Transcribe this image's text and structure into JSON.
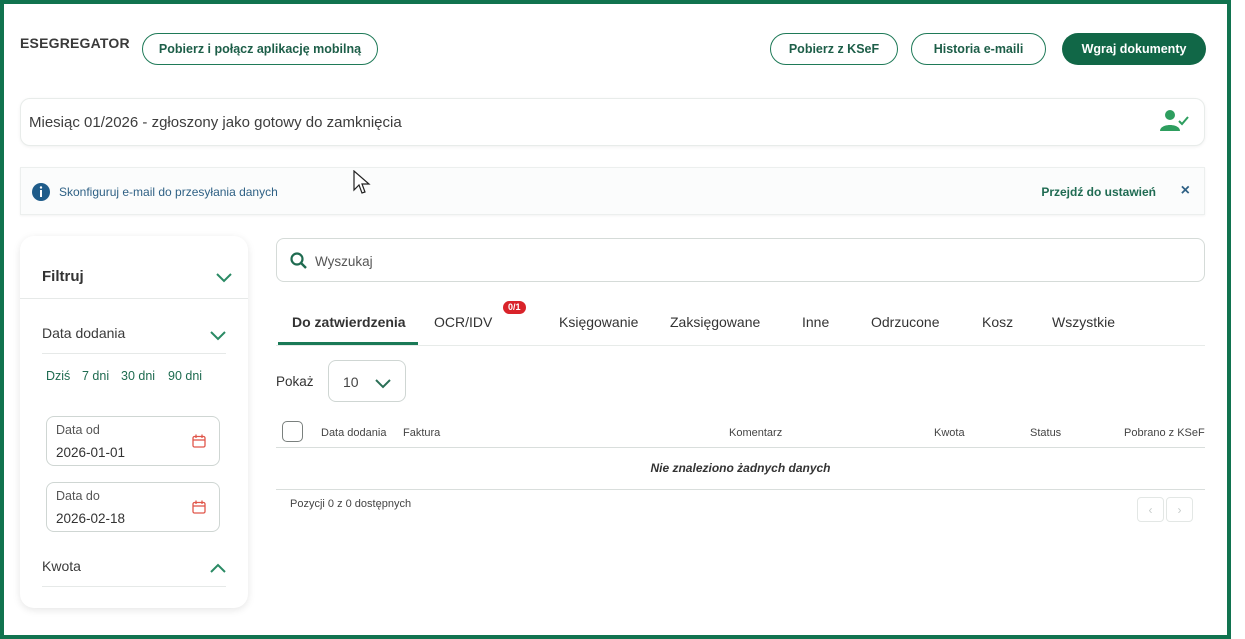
{
  "app": {
    "brand": "ESEGREGATOR"
  },
  "header": {
    "mobile_app_button": "Pobierz i połącz aplikację mobilną",
    "ksef_button": "Pobierz z KSeF",
    "email_history_button": "Historia e-maili",
    "upload_button": "Wgraj dokumenty"
  },
  "month_status": {
    "text": "Miesiąc 01/2026 - zgłoszony jako gotowy do zamknięcia"
  },
  "info_banner": {
    "text": "Skonfiguruj e-mail do przesyłania danych",
    "link": "Przejdź do ustawień",
    "close": "×"
  },
  "filters": {
    "title": "Filtruj",
    "date_added_label": "Data dodania",
    "quick_ranges": [
      "Dziś",
      "7 dni",
      "30 dni",
      "90 dni"
    ],
    "date_from": {
      "label": "Data od",
      "value": "2026-01-01"
    },
    "date_to": {
      "label": "Data do",
      "value": "2026-02-18"
    },
    "amount_label": "Kwota"
  },
  "search": {
    "placeholder": "Wyszukaj"
  },
  "tabs": [
    {
      "label": "Do zatwierdzenia",
      "active": true
    },
    {
      "label": "OCR/IDV",
      "badge": "0/1"
    },
    {
      "label": "Księgowanie"
    },
    {
      "label": "Zaksięgowane"
    },
    {
      "label": "Inne"
    },
    {
      "label": "Odrzucone"
    },
    {
      "label": "Kosz"
    },
    {
      "label": "Wszystkie"
    }
  ],
  "page_size": {
    "label": "Pokaż",
    "value": "10"
  },
  "table": {
    "columns": [
      "Data dodania",
      "Faktura",
      "Komentarz",
      "Kwota",
      "Status",
      "Pobrano z KSeF"
    ],
    "empty_message": "Nie znaleziono żadnych danych"
  },
  "pagination": {
    "summary": "Pozycji 0 z 0 dostępnych",
    "prev": "‹",
    "next": "›"
  },
  "colors": {
    "brand_green": "#116747",
    "frame": "#11734f",
    "badge_red": "#d9232a",
    "info_blue": "#2f6185"
  }
}
